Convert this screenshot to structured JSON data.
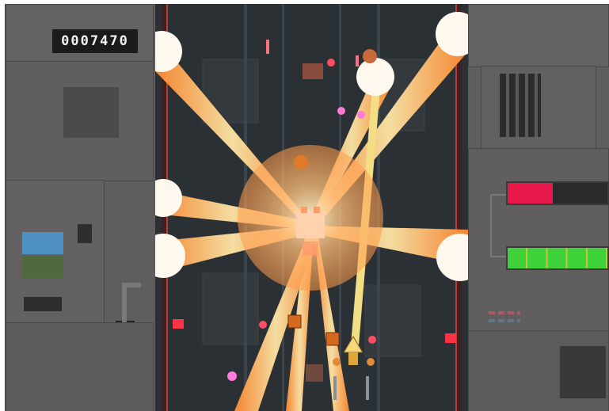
{
  "hud": {
    "score": "0007470",
    "health_fraction": 0.45,
    "power_fraction": 1.0,
    "power_segments": 5
  },
  "colors": {
    "health": "#e8194a",
    "power": "#3fd23a",
    "beam": "#ffb347",
    "beam_core": "#fff6c8",
    "floor": "#2b3034"
  },
  "icons": [
    "player-ship-icon",
    "boss-enemy-icon",
    "drone-enemy-icon",
    "enemy-bullet-icon",
    "laser-beam-icon"
  ]
}
